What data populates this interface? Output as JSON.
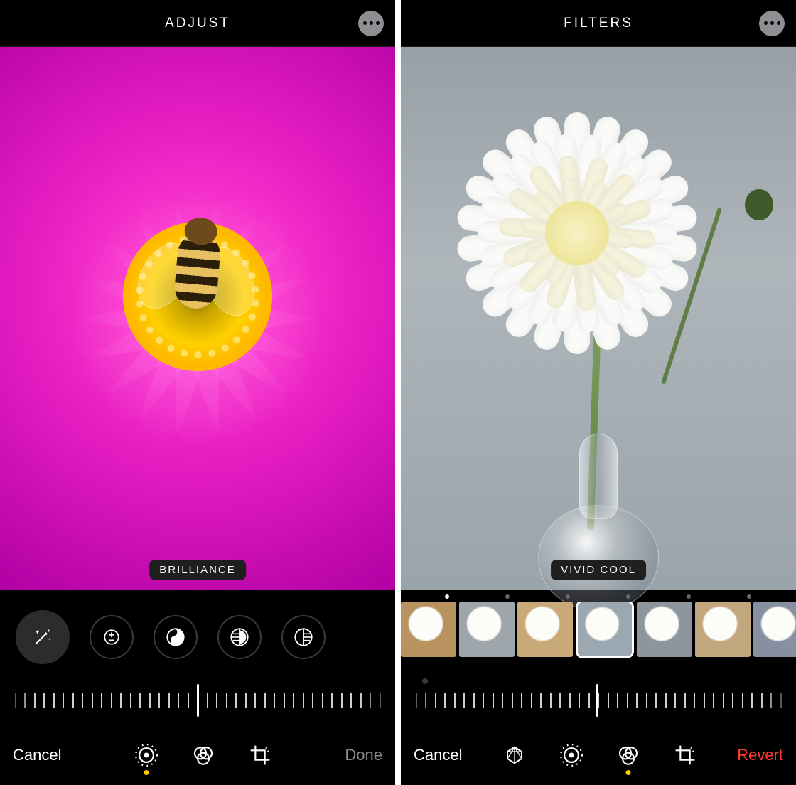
{
  "left": {
    "header": {
      "title": "ADJUST"
    },
    "badge": "BRILLIANCE",
    "dials": [
      {
        "name": "auto-enhance-icon"
      },
      {
        "name": "exposure-icon"
      },
      {
        "name": "brilliance-icon"
      },
      {
        "name": "highlights-icon"
      },
      {
        "name": "shadows-icon"
      }
    ],
    "footer": {
      "cancel": "Cancel",
      "done": "Done"
    }
  },
  "right": {
    "header": {
      "title": "FILTERS"
    },
    "badge": "VIVID COOL",
    "filters": [
      {
        "name": "original"
      },
      {
        "name": "vivid"
      },
      {
        "name": "vivid-warm"
      },
      {
        "name": "vivid-cool",
        "selected": true
      },
      {
        "name": "dramatic"
      },
      {
        "name": "dramatic-warm"
      },
      {
        "name": "dramatic-cool"
      }
    ],
    "footer": {
      "cancel": "Cancel",
      "revert": "Revert"
    }
  },
  "tabs": {
    "adjust": "adjust-tab",
    "filters": "filters-tab",
    "crop": "crop-tab",
    "markup": "markup-tab"
  }
}
